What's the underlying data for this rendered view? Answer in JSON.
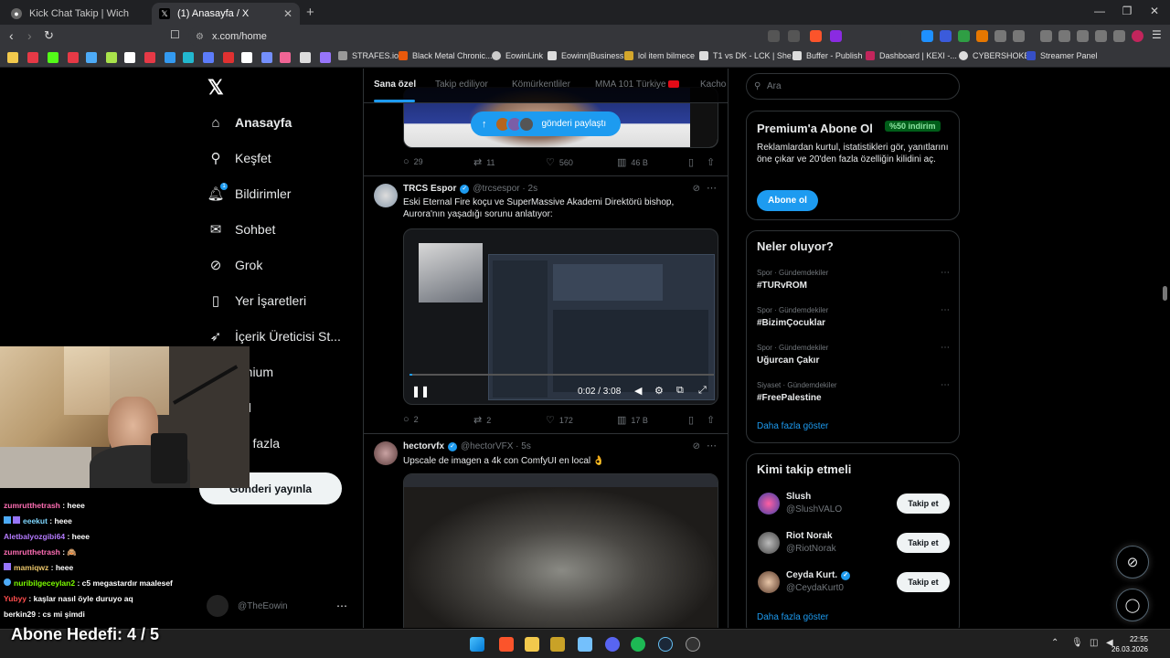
{
  "browser": {
    "tabs": [
      {
        "title": "Kick Chat Takip | Wich"
      },
      {
        "title": "(1) Anasayfa / X"
      }
    ],
    "url": "x.com/home",
    "bookmarks": [
      "STRAFES.io",
      "Black Metal Chronic...",
      "EowinLink",
      "Eowinn|Business",
      "lol item bilmece",
      "T1 vs DK - LCK | She...",
      "Buffer - Publish",
      "Dashboard | KEXI -...",
      "CYBERSHOKE",
      "Streamer Panel"
    ]
  },
  "nav": {
    "items": [
      {
        "label": "Anasayfa",
        "icon": "home-icon"
      },
      {
        "label": "Keşfet",
        "icon": "search-icon"
      },
      {
        "label": "Bildirimler",
        "icon": "bell-icon",
        "badge": "1"
      },
      {
        "label": "Sohbet",
        "icon": "mail-icon"
      },
      {
        "label": "Grok",
        "icon": "grok-icon"
      },
      {
        "label": "Yer İşaretleri",
        "icon": "bookmark-icon"
      },
      {
        "label": "İçerik Üreticisi St...",
        "icon": "rocket-icon"
      },
      {
        "label": "emium",
        "icon": "premium-icon"
      },
      {
        "label": "ofil",
        "icon": "profile-icon"
      },
      {
        "label": "ha fazla",
        "icon": "more-icon"
      }
    ],
    "post_button": "Gönderi yayınla",
    "account_handle": "@TheEowin"
  },
  "feed": {
    "tabs": [
      "Sana özel",
      "Takip ediliyor",
      "Kömürkentliler",
      "MMA 101 Türkiye",
      "Kacho"
    ],
    "share_pill": "gönderi paylaştı",
    "post0_actions": {
      "replies": "29",
      "reposts": "11",
      "likes": "560",
      "views": "46 B"
    },
    "posts": [
      {
        "name": "TRCS Espor",
        "handle": "@trcsespor · 2s",
        "text": "Eski Eternal Fire koçu ve SuperMassive Akademi Direktörü bishop, Aurora'nın yaşadığı sorunu anlatıyor:",
        "video_time": "0:02 / 3:08",
        "replies": "2",
        "reposts": "2",
        "likes": "172",
        "views": "17 B"
      },
      {
        "name": "hectorvfx",
        "handle": "@hectorVFX · 5s",
        "text": "Upscale de imagen a 4k con ComfyUI en local 👌"
      }
    ]
  },
  "sidebar": {
    "search_placeholder": "Ara",
    "premium": {
      "title": "Premium'a Abone Ol",
      "discount": "%50 indirim",
      "text": "Reklamlardan kurtul, istatistikleri gör, yanıtlarını öne çıkar ve 20'den fazla özelliğin kilidini aç.",
      "button": "Abone ol"
    },
    "trends": {
      "title": "Neler oluyor?",
      "items": [
        {
          "category": "Spor · Gündemdekiler",
          "name": "#TURvROM"
        },
        {
          "category": "Spor · Gündemdekiler",
          "name": "#BizimÇocuklar"
        },
        {
          "category": "Spor · Gündemdekiler",
          "name": "Uğurcan Çakır"
        },
        {
          "category": "Siyaset · Gündemdekiler",
          "name": "#FreePalestine"
        }
      ],
      "show_more": "Daha fazla göster"
    },
    "who_to_follow": {
      "title": "Kimi takip etmeli",
      "items": [
        {
          "name": "Slush",
          "handle": "@SlushVALO",
          "button": "Takip et"
        },
        {
          "name": "Riot Norak",
          "handle": "@RiotNorak",
          "button": "Takip et"
        },
        {
          "name": "Ceyda Kurt.",
          "handle": "@CeydaKurt0",
          "button": "Takip et"
        }
      ],
      "show_more": "Daha fazla göster"
    }
  },
  "stream": {
    "chat": [
      {
        "user": "zumrutthetrash",
        "msg": " : heee",
        "color": "#ff6eb4"
      },
      {
        "user": "eeekut",
        "msg": " : heee",
        "color": "#7fd7ff"
      },
      {
        "user": "Aletbalyozgibi64",
        "msg": " : heee",
        "color": "#b57bff"
      },
      {
        "user": "zumrutthetrash",
        "msg": " : 🙈",
        "color": "#ff6eb4"
      },
      {
        "user": "mamiqwz",
        "msg": " : heee",
        "color": "#e9c46a"
      },
      {
        "user": "nuribilgeceylan2",
        "msg": " : c5 megastardır maalesef",
        "color": "#7CFC00"
      },
      {
        "user": "Yubyy",
        "msg": " : kaşlar nasıl öyle duruyo aq",
        "color": "#ff4d4d"
      },
      {
        "user": "berkin29",
        "msg": " : cs mi şimdi",
        "color": "#ffffff"
      }
    ],
    "sub_goal": "Abone Hedefi:  4 / 5"
  },
  "taskbar": {
    "time": "22:55",
    "date": "26.03.2026"
  }
}
